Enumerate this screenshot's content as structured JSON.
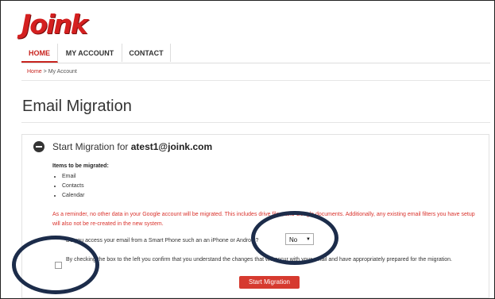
{
  "brand": {
    "logo_text": "Joink"
  },
  "nav": {
    "tabs": [
      "HOME",
      "MY ACCOUNT",
      "CONTACT"
    ],
    "active": "HOME"
  },
  "breadcrumb": {
    "home": "Home",
    "separator": ">",
    "current": "My Account"
  },
  "page": {
    "title": "Email Migration"
  },
  "panel": {
    "heading_prefix": "Start Migration for",
    "email": "atest1@joink.com",
    "items_label": "Items to be migrated:",
    "items": [
      "Email",
      "Contacts",
      "Calendar"
    ],
    "warning": "As a reminder, no other data in your Google account will be migrated. This includes drive files, and Google documents. Additionally, any existing email filters you have setup will also not be re-created in the new system.",
    "question": "Do you access your email from a Smart Phone such an an iPhone or Android?",
    "select_value": "No",
    "confirm_text": "By checking the box to the left you confirm that you understand the changes that will occur with your email and have appropriately prepared for the migration.",
    "checkbox_checked": false,
    "button_label": "Start Migration"
  },
  "colors": {
    "accent": "#c8241f",
    "button": "#d63a2f",
    "annotation_circle": "#1c2c4a"
  }
}
